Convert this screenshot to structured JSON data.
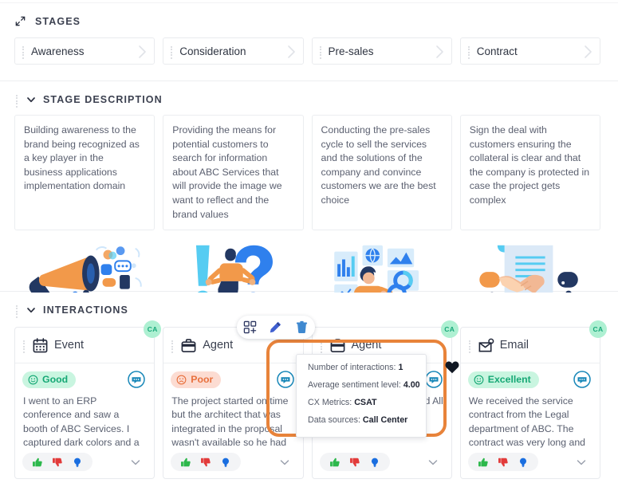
{
  "colors": {
    "accent_orange": "#e8833a",
    "good_bg": "#c9f5e0",
    "good_fg": "#16a875",
    "poor_bg": "#fcdcd2",
    "poor_fg": "#e8713e",
    "ca_bg": "#aef0d2",
    "ca_fg": "#18a97a",
    "text": "#3c4150",
    "muted": "#5b6070"
  },
  "stages": {
    "title": "STAGES",
    "expand_icon": "expand-diagonal-icon",
    "tabs": [
      {
        "label": "Awareness"
      },
      {
        "label": "Consideration"
      },
      {
        "label": "Pre-sales"
      },
      {
        "label": "Contract"
      }
    ]
  },
  "stage_description": {
    "title": "STAGE DESCRIPTION",
    "caret_icon": "chevron-down-icon",
    "cards": [
      {
        "text": "Building awareness to the brand being recognized as a key player in the business applications implementation domain",
        "illustration": "megaphone-marketing-illustration"
      },
      {
        "text": "Providing the means for potential customers to search for information about ABC Services that will provide the image we want to reflect and the brand values",
        "illustration": "question-exclamation-illustration"
      },
      {
        "text": "Conducting the pre-sales cycle to sell the services and the solutions of the company and convince customers we are the best choice",
        "illustration": "analyst-dashboard-illustration"
      },
      {
        "text": "Sign the deal with customers ensuring the collateral is clear and that the company is protected in case the project gets complex",
        "illustration": "handshake-contract-illustration"
      }
    ]
  },
  "interactions": {
    "title": "INTERACTIONS",
    "caret_icon": "chevron-down-icon",
    "toolbar": [
      {
        "name": "duplicate-icon",
        "label": "Duplicate"
      },
      {
        "name": "edit-pencil-icon",
        "label": "Edit"
      },
      {
        "name": "trash-icon",
        "label": "Delete"
      }
    ],
    "reactions": [
      {
        "name": "thumbs-up-icon",
        "color": "#2db84c"
      },
      {
        "name": "thumbs-down-icon",
        "color": "#e23a3a"
      },
      {
        "name": "lightbulb-icon",
        "color": "#1a6ee0"
      }
    ],
    "cards": [
      {
        "type": "Event",
        "type_icon": "calendar-icon",
        "badge": "CA",
        "sentiment": "Good",
        "sentiment_style": "good",
        "sentiment_icon": "smiley-face-icon",
        "body": "I went to an ERP conference and saw a booth of ABC Services. I captured dark colors and a pretty big space. They are"
      },
      {
        "type": "Agent",
        "type_icon": "briefcase-icon",
        "badge": "",
        "sentiment": "Poor",
        "sentiment_style": "poor",
        "sentiment_icon": "frowny-face-icon",
        "body": "The project started on time but the architect that was integrated in the proposal wasn't available so he had to be"
      },
      {
        "type": "Agent",
        "type_icon": "briefcase-icon",
        "badge": "CA",
        "sentiment": "",
        "sentiment_style": "hidden",
        "sentiment_icon": "",
        "body": "us and All"
      },
      {
        "type": "Email",
        "type_icon": "envelope-icon",
        "badge": "CA",
        "sentiment": "Excellent",
        "sentiment_style": "exc",
        "sentiment_icon": "smiley-face-icon",
        "body": "We received the service contract from the Legal department of ABC. The contract was very long and we"
      }
    ],
    "tooltip": {
      "lines": [
        {
          "label": "Number of interactions:",
          "value": "1"
        },
        {
          "label": "Average sentiment level:",
          "value": "4.00"
        },
        {
          "label": "CX Metrics:",
          "value": "CSAT"
        },
        {
          "label": "Data sources:",
          "value": "Call Center"
        }
      ]
    },
    "heart_icon": "heart-filled-icon"
  }
}
